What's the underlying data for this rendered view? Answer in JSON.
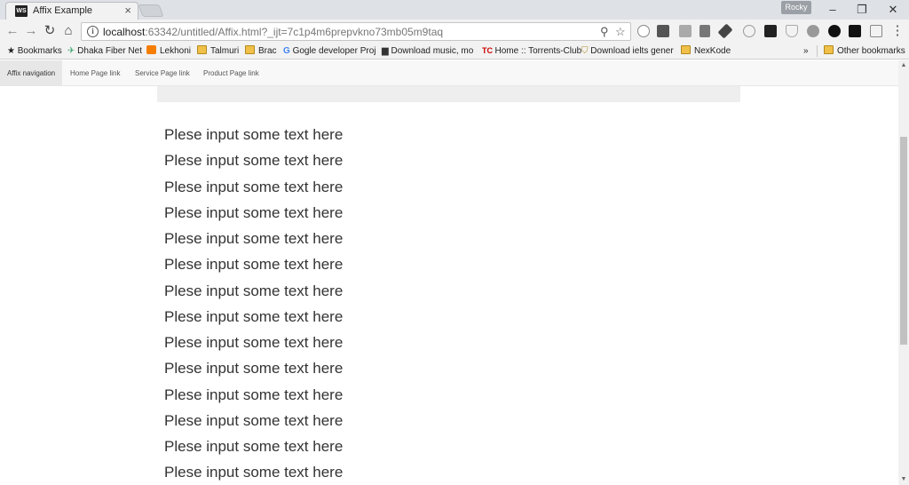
{
  "browser": {
    "tab": {
      "favicon_text": "WS",
      "title": "Affix Example"
    },
    "profile_name": "Rocky",
    "url": {
      "host": "localhost",
      "rest": ":63342/untitled/Affix.html?_ijt=7c1p4m6prepvkno73mb05m9taq"
    }
  },
  "bookmarks": [
    {
      "label": "Bookmarks",
      "icon": "star-icon"
    },
    {
      "label": "Dhaka Fiber Net",
      "icon": "bird-icon"
    },
    {
      "label": "Lekhoni",
      "icon": "blogger-icon"
    },
    {
      "label": "Talmuri",
      "icon": "folder-icon"
    },
    {
      "label": "Brac",
      "icon": "folder-icon"
    },
    {
      "label": "Gogle developer Proj",
      "icon": "google-icon"
    },
    {
      "label": "Download music, mo",
      "icon": "bus-icon"
    },
    {
      "label": "Home :: Torrents-Club",
      "icon": "tc-icon"
    },
    {
      "label": "Download ielts gener",
      "icon": "shield-icon"
    },
    {
      "label": "NexKode",
      "icon": "folder-icon"
    }
  ],
  "bookmarks_overflow": "»",
  "other_bookmarks": "Other bookmarks",
  "page": {
    "nav": [
      "Affix navigation",
      "Home Page link",
      "Service Page link",
      "Product Page link"
    ],
    "lines": [
      "Plese input some text here",
      "Plese input some text here",
      "Plese input some text here",
      "Plese input some text here",
      "Plese input some text here",
      "Plese input some text here",
      "Plese input some text here",
      "Plese input some text here",
      "Plese input some text here",
      "Plese input some text here",
      "Plese input some text here",
      "Plese input some text here",
      "Plese input some text here",
      "Plese input some text here"
    ]
  }
}
